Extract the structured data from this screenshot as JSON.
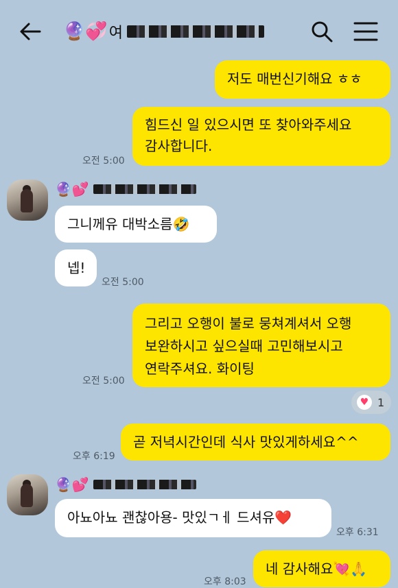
{
  "header": {
    "title_emoji": "🔮💞",
    "title_prefix": "여"
  },
  "sender": {
    "emoji": "🔮💕"
  },
  "messages": {
    "m1": "저도 매번신기해요 ㅎㅎ",
    "m2_line1": "힘드신 일 있으시면 또 찾아와주세요",
    "m2_line2": "감사합니다.",
    "m2_time": "오전 5:00",
    "m3": "그니께유 대박소름🤣",
    "m4": "넵!",
    "m4_time": "오전 5:00",
    "m5_line1": "그리고 오행이 불로 뭉쳐계셔서 오행",
    "m5_line2": "보완하시고 싶으실때 고민해보시고",
    "m5_line3": "연락주셔요. 화이팅",
    "m5_time": "오전 5:00",
    "m5_reaction_count": "1",
    "m6": "곧 저녁시간인데 식사 맛있게하세요^^",
    "m6_time": "오후 6:19",
    "m7": "아뇨아뇨 괜찮아용- 맛있ㄱㅔ 드셔유❤️",
    "m7_time": "오후 6:31",
    "m8": "네 감사해요💘🙏",
    "m8_time": "오후 8:03"
  }
}
